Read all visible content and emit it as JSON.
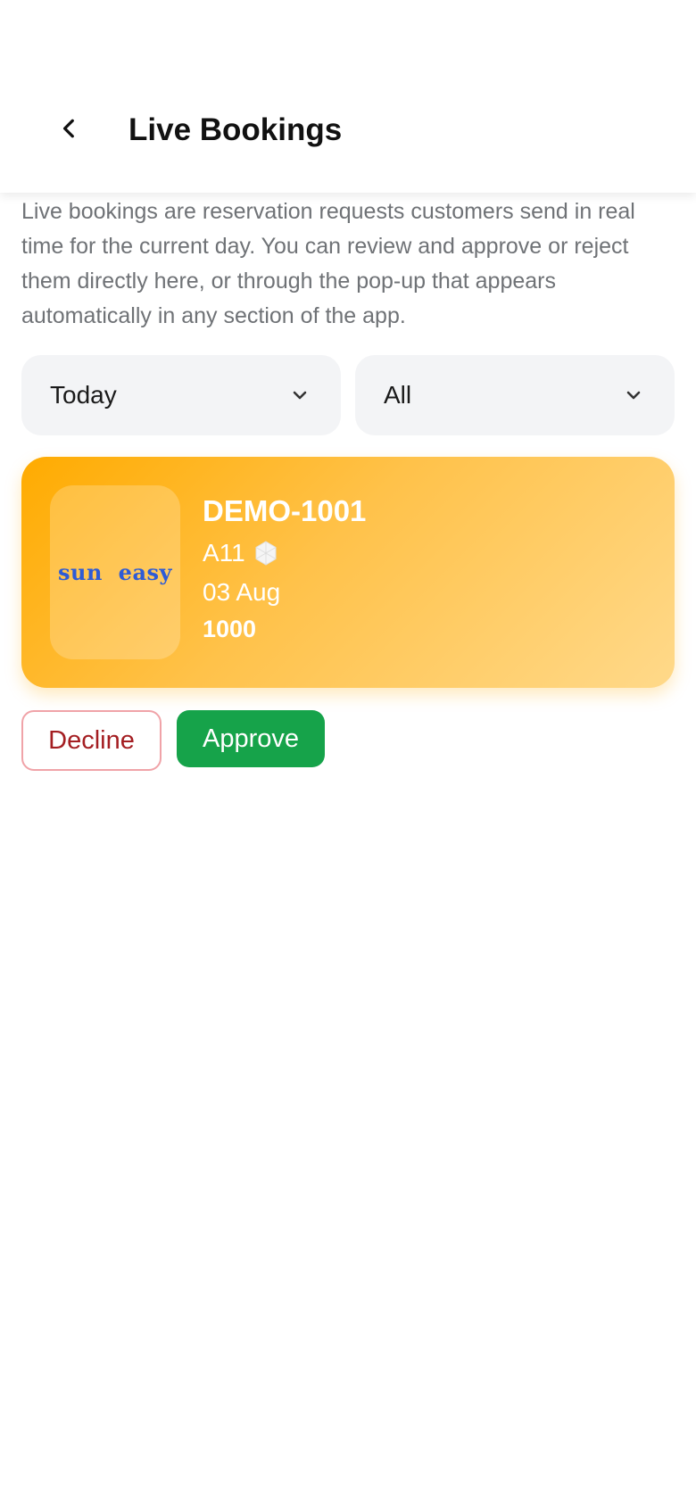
{
  "header": {
    "title": "Live Bookings",
    "back_icon": "chevron-left-icon"
  },
  "description": "Live bookings are reservation requests customers send in real time for the current day. You can review and approve or reject them directly here, or through the pop-up that appears automatically in any section of the app.",
  "filters": {
    "date": {
      "selected": "Today",
      "icon": "chevron-down-icon"
    },
    "status": {
      "selected": "All",
      "icon": "chevron-down-icon"
    }
  },
  "booking": {
    "logo_text": "sun  easy",
    "code": "DEMO-1001",
    "spot": "A11",
    "spot_icon": "umbrella-icon",
    "date": "03 Aug",
    "price": "1000",
    "colors": {
      "card_start": "#ffab00",
      "card_end": "#ffd98a",
      "logo": "#2d5bd6"
    }
  },
  "actions": {
    "decline_label": "Decline",
    "approve_label": "Approve",
    "colors": {
      "decline_text": "#a41e22",
      "decline_border": "#f0a3a8",
      "approve_bg": "#16a34a"
    }
  }
}
